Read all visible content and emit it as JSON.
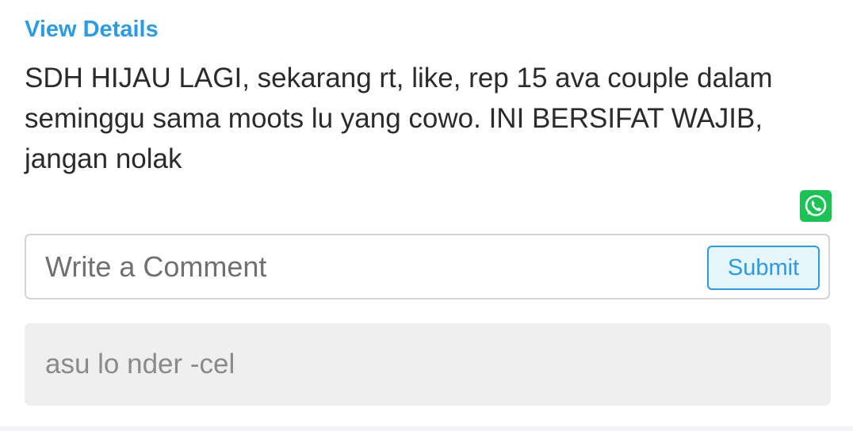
{
  "post": {
    "view_details_label": "View Details",
    "text": "SDH HIJAU LAGI, sekarang rt, like, rep 15 ava couple dalam\nseminggu sama moots lu yang cowo. INI BERSIFAT WAJIB,\njangan nolak"
  },
  "share": {
    "icon": "whatsapp-icon",
    "color": "#1bc254"
  },
  "comment_form": {
    "placeholder": "Write a Comment",
    "value": "",
    "submit_label": "Submit"
  },
  "comments": [
    {
      "text": "asu lo nder -cel"
    }
  ],
  "colors": {
    "accent": "#2b9be3",
    "text": "#2b2b2b",
    "comment_bg": "#efefef"
  }
}
